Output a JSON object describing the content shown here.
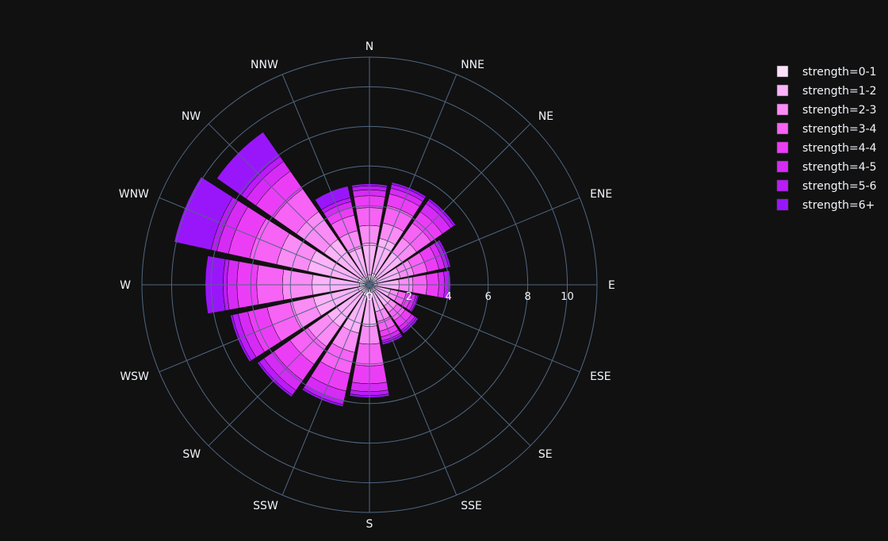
{
  "chart_data": {
    "type": "barpolar",
    "directions": [
      "N",
      "NNE",
      "NE",
      "ENE",
      "E",
      "ESE",
      "SE",
      "SSE",
      "S",
      "SSW",
      "SW",
      "WSW",
      "W",
      "WNW",
      "NW",
      "NNW"
    ],
    "radial_ticks": [
      "0",
      "2",
      "4",
      "6",
      "8",
      "10"
    ],
    "radial_range": [
      0,
      11.5
    ],
    "series": [
      {
        "name": "strength=0-1",
        "color": "#fde0f9",
        "values": [
          0.5,
          0.6,
          0.5,
          0.4,
          0.4,
          0.3,
          0.4,
          0.4,
          0.5,
          0.6,
          0.5,
          0.6,
          0.5,
          0.6,
          0.5,
          0.4
        ]
      },
      {
        "name": "strength=1-2",
        "color": "#fcb3f7",
        "values": [
          1.6,
          1.8,
          1.5,
          1.2,
          1.1,
          0.8,
          0.9,
          1.0,
          1.6,
          1.9,
          2.1,
          2.3,
          2.4,
          2.6,
          2.3,
          1.5
        ]
      },
      {
        "name": "strength=2-3",
        "color": "#fa8cf5",
        "values": [
          0.9,
          0.8,
          0.9,
          0.7,
          0.7,
          0.4,
          0.4,
          0.5,
          0.9,
          1.0,
          1.2,
          1.2,
          1.5,
          1.6,
          1.7,
          0.9
        ]
      },
      {
        "name": "strength=3-4",
        "color": "#f763f5",
        "values": [
          0.9,
          0.9,
          0.9,
          0.7,
          0.7,
          0.4,
          0.5,
          0.5,
          1.1,
          1.1,
          1.1,
          1.2,
          1.3,
          1.4,
          1.4,
          0.8
        ]
      },
      {
        "name": "strength=4-4",
        "color": "#ec3df6",
        "values": [
          0.6,
          0.6,
          0.7,
          0.6,
          0.6,
          0.3,
          0.4,
          0.3,
          0.9,
          0.9,
          1.0,
          1.0,
          1.0,
          1.1,
          1.1,
          0.4
        ]
      },
      {
        "name": "strength=4-5",
        "color": "#d62bf5",
        "values": [
          0.3,
          0.3,
          0.5,
          0.3,
          0.3,
          0.2,
          0.2,
          0.2,
          0.4,
          0.5,
          0.6,
          0.5,
          0.5,
          0.6,
          0.6,
          0.3
        ]
      },
      {
        "name": "strength=5-6",
        "color": "#bb1bf8",
        "values": [
          0.2,
          0.2,
          0.2,
          0.2,
          0.2,
          0.1,
          0.1,
          0.1,
          0.2,
          0.2,
          0.3,
          0.3,
          0.2,
          0.3,
          0.3,
          0.2
        ]
      },
      {
        "name": "strength=6+",
        "color": "#9a16fa",
        "values": [
          0.1,
          0.1,
          0.1,
          0.1,
          0.1,
          0.05,
          0.1,
          0.1,
          0.1,
          0.1,
          0.1,
          0.1,
          0.9,
          1.9,
          1.5,
          0.6
        ]
      }
    ]
  }
}
